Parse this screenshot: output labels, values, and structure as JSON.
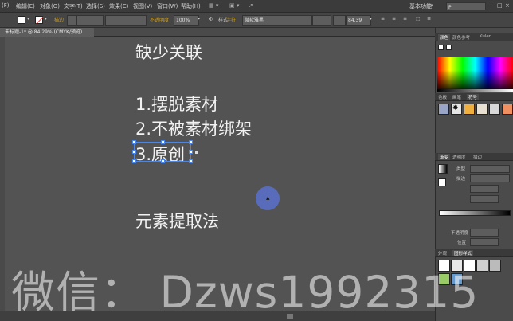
{
  "menubar": {
    "items": [
      "(F)",
      "编辑(E)",
      "对象(O)",
      "文字(T)",
      "选择(S)",
      "效果(C)",
      "视图(V)",
      "窗口(W)",
      "帮助(H)"
    ],
    "workspace": "基本功能",
    "search_placeholder": "P"
  },
  "controlbar": {
    "stroke_label": "描边",
    "opacity_label": "不透明度",
    "opacity_value": "100%",
    "style_label": "样式",
    "char_label": "字符",
    "font_value": "微软雅黑",
    "size_value": "84.39"
  },
  "document": {
    "tab_label": "未标题-1* @ 84.29% (CMYK/预览)"
  },
  "artboard": {
    "lines": [
      "缺少关联",
      "1.摆脱素材",
      "2.不被素材绑架",
      "3.原创",
      "元素提取法"
    ]
  },
  "panels": {
    "color_tabs": [
      "颜色",
      "颜色参考",
      "Kuler"
    ],
    "swatch_tabs": [
      "色板",
      "画笔",
      "符号"
    ],
    "gradient_tabs": [
      "渐变",
      "透明度",
      "描边"
    ],
    "gradient_fields": [
      "类型",
      "描边",
      "",
      ""
    ],
    "position_labels": [
      "不透明度",
      "位置"
    ],
    "appearance_tabs": [
      "外观",
      "图形样式"
    ]
  },
  "watermark": {
    "text": "微信： Dzws1992315"
  }
}
